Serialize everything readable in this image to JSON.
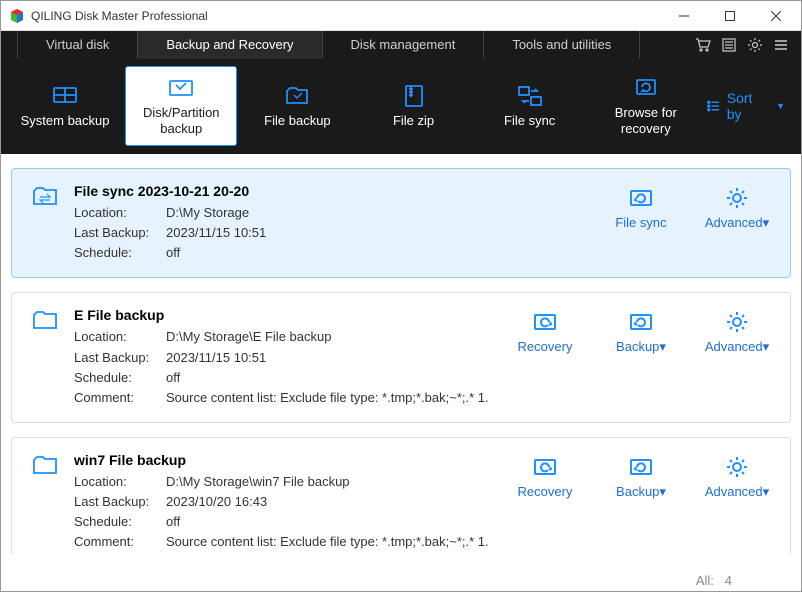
{
  "window": {
    "title": "QILING Disk Master Professional"
  },
  "tabs": [
    "Virtual disk",
    "Backup and Recovery",
    "Disk management",
    "Tools and utilities"
  ],
  "toolbar": {
    "items": [
      {
        "label": "System backup"
      },
      {
        "label": "Disk/Partition backup"
      },
      {
        "label": "File backup"
      },
      {
        "label": "File zip"
      },
      {
        "label": "File sync"
      },
      {
        "label": "Browse for recovery"
      }
    ],
    "sort_label": "Sort by"
  },
  "labels": {
    "location": "Location:",
    "last_backup": "Last Backup:",
    "schedule": "Schedule:",
    "comment": "Comment:"
  },
  "tasks": [
    {
      "title": "File sync 2023-10-21 20-20",
      "location": "D:\\My Storage",
      "last_backup": "2023/11/15 10:51",
      "schedule": "off",
      "comment": "",
      "actions": [
        {
          "label": "File sync"
        },
        {
          "label": "Advanced▾"
        }
      ],
      "selected": true
    },
    {
      "title": "E  File backup",
      "location": "D:\\My Storage\\E  File backup",
      "last_backup": "2023/11/15 10:51",
      "schedule": "off",
      "comment": "Source content list:  Exclude file type: *.tmp;*.bak;~*;.*        1.",
      "actions": [
        {
          "label": "Recovery"
        },
        {
          "label": "Backup▾"
        },
        {
          "label": "Advanced▾"
        }
      ],
      "selected": false
    },
    {
      "title": "win7 File backup",
      "location": "D:\\My Storage\\win7 File backup",
      "last_backup": "2023/10/20 16:43",
      "schedule": "off",
      "comment": "Source content list:  Exclude file type: *.tmp;*.bak;~*;.*        1.",
      "actions": [
        {
          "label": "Recovery"
        },
        {
          "label": "Backup▾"
        },
        {
          "label": "Advanced▾"
        }
      ],
      "selected": false
    }
  ],
  "footer": {
    "all_label": "All:",
    "count": "4"
  }
}
